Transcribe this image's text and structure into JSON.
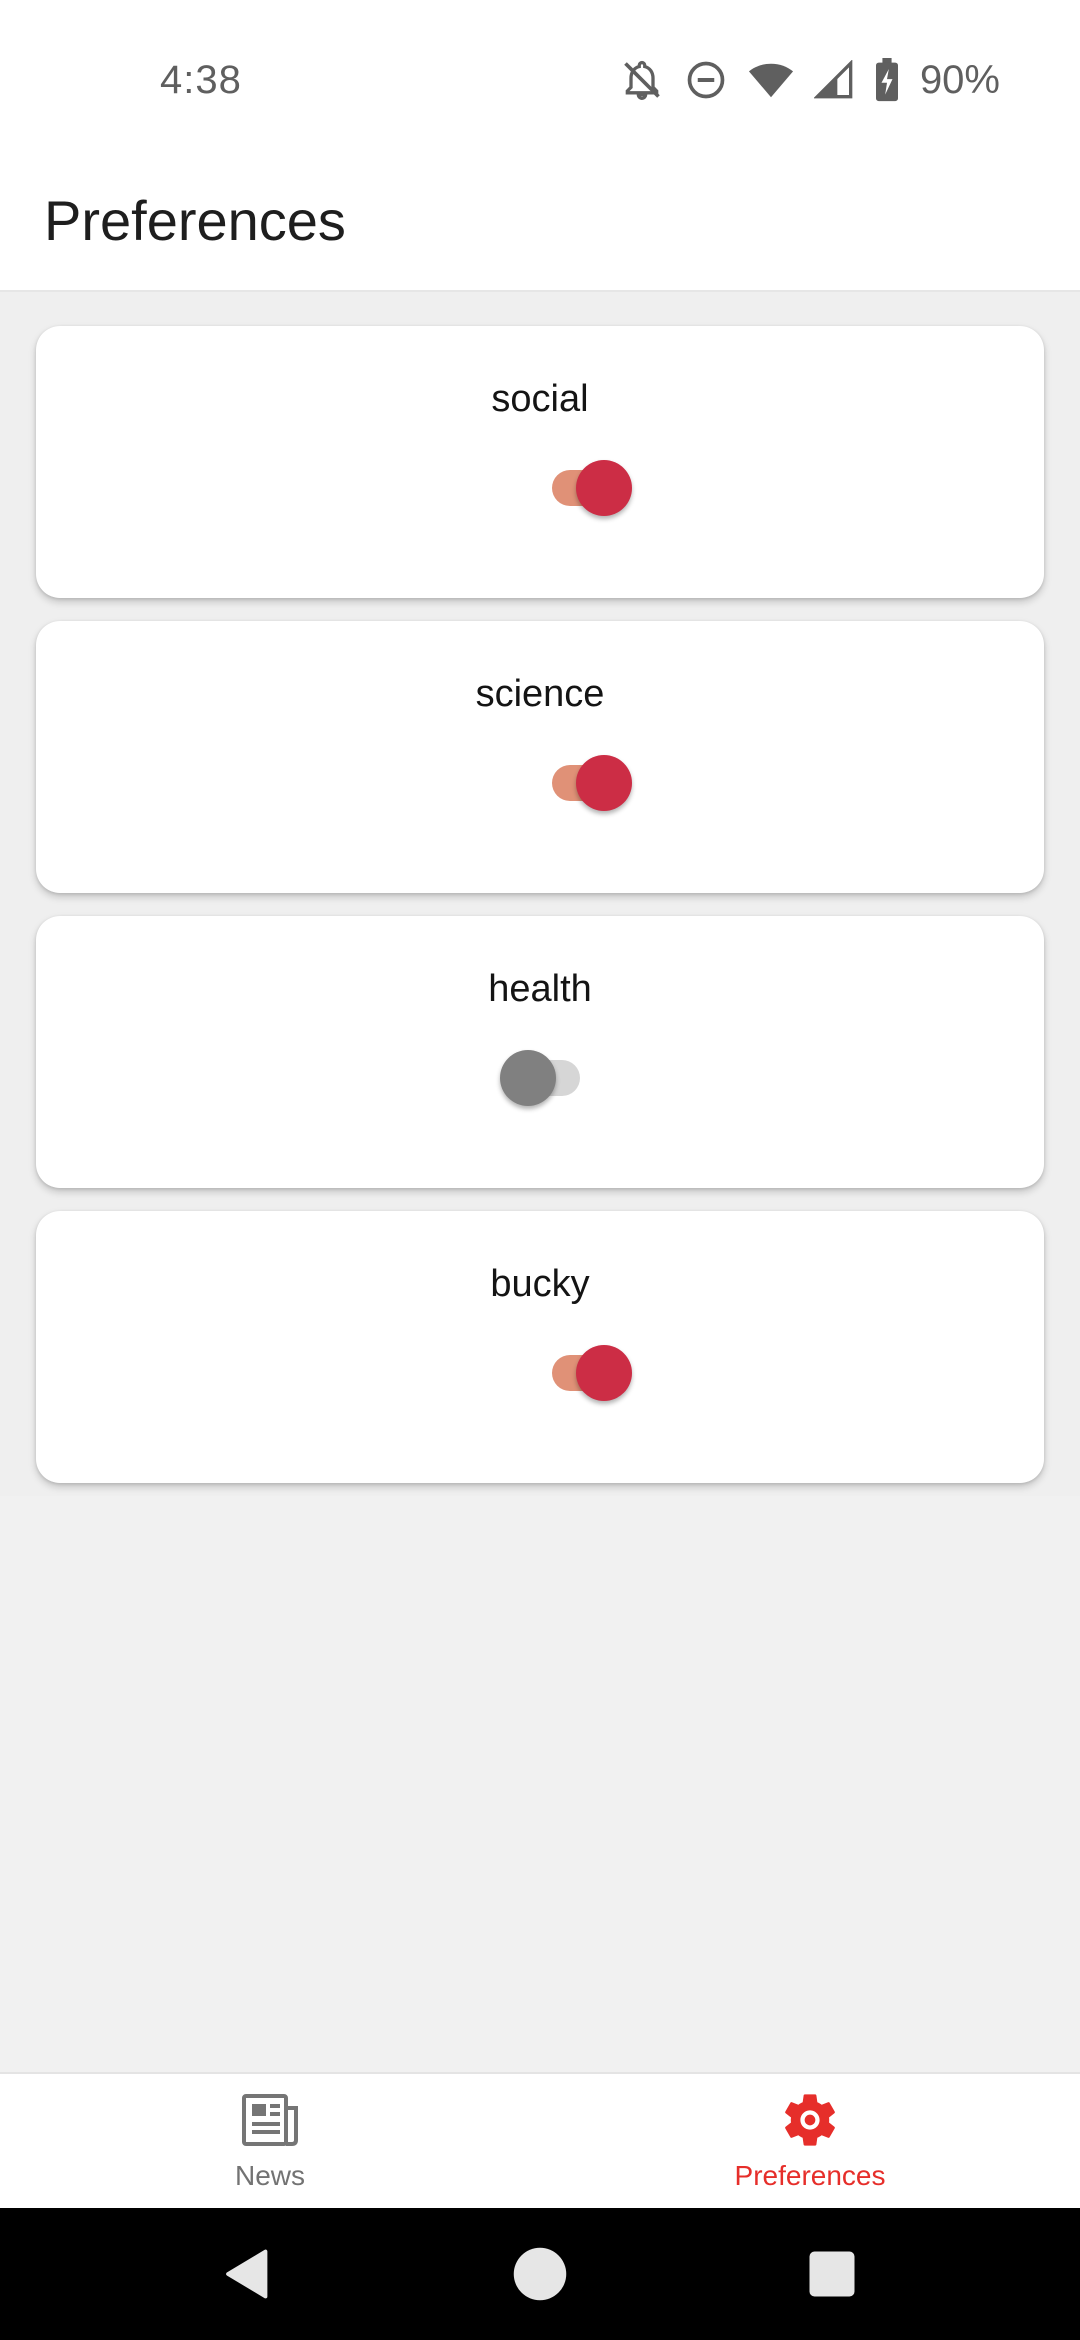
{
  "status_bar": {
    "time": "4:38",
    "battery": "90%",
    "icons": [
      "notifications-off-icon",
      "do-not-disturb-icon",
      "wifi-icon",
      "cellular-signal-icon",
      "battery-charging-icon"
    ]
  },
  "header": {
    "title": "Preferences"
  },
  "preferences": [
    {
      "label": "social",
      "enabled": true
    },
    {
      "label": "science",
      "enabled": true
    },
    {
      "label": "health",
      "enabled": false
    },
    {
      "label": "bucky",
      "enabled": true
    }
  ],
  "bottom_nav": {
    "items": [
      {
        "label": "News",
        "icon": "newspaper-icon",
        "active": false
      },
      {
        "label": "Preferences",
        "icon": "gear-icon",
        "active": true
      }
    ]
  },
  "system_nav": {
    "buttons": [
      "back-icon",
      "home-icon",
      "recents-icon"
    ]
  },
  "colors": {
    "accent": "#e62e2a",
    "switch_on_thumb": "#cc2d45",
    "switch_on_track": "#e09177",
    "switch_off_thumb": "#808080",
    "switch_off_track": "#d6d6d6"
  }
}
